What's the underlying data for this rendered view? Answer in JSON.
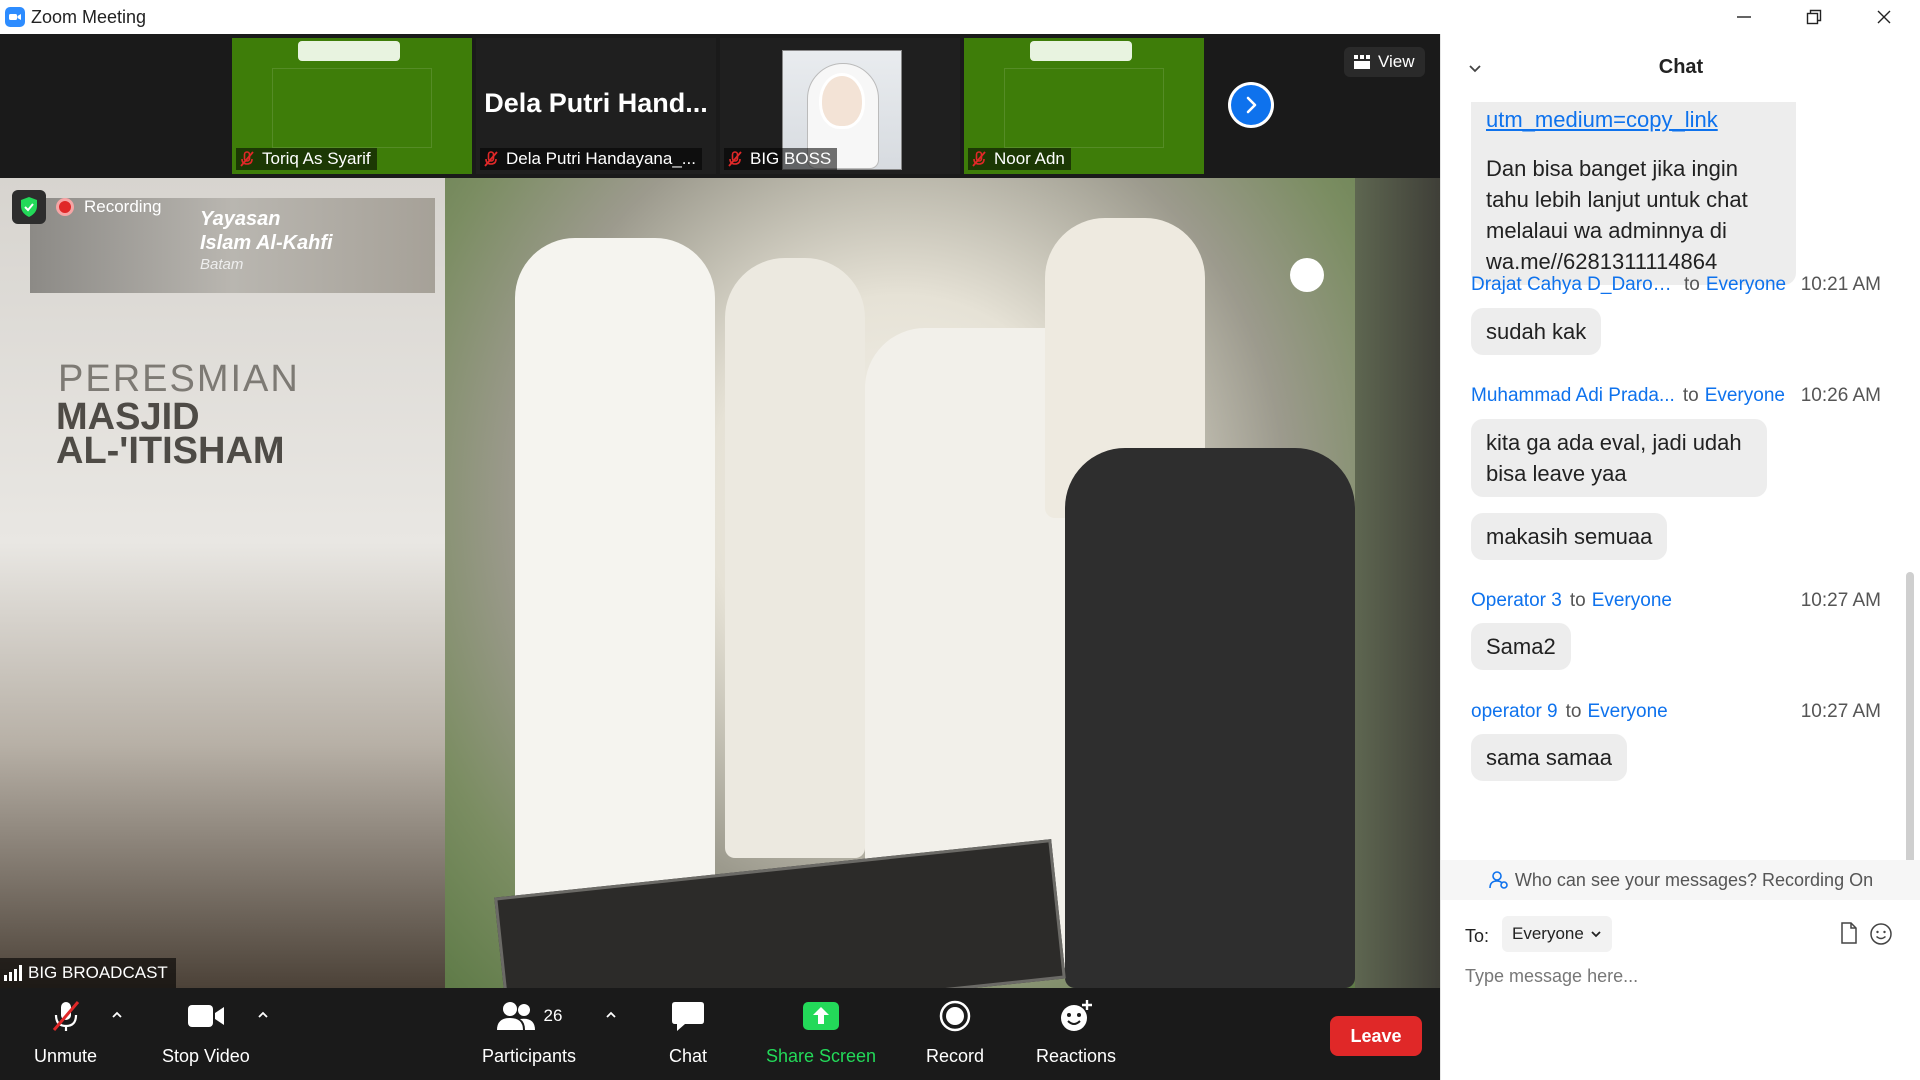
{
  "window": {
    "title": "Zoom Meeting",
    "controls": [
      "minimize-icon",
      "restore-icon",
      "close-icon"
    ]
  },
  "gallery": {
    "tiles": [
      {
        "name": "Toriq As Syarif",
        "muted": true,
        "style": "green-banner"
      },
      {
        "name": "Dela Putri Handayana_...",
        "big_name": "Dela Putri  Hand...",
        "muted": true,
        "style": "name-only"
      },
      {
        "name": "BIG BOSS",
        "muted": true,
        "style": "avatar"
      },
      {
        "name": "Noor Adn",
        "muted": true,
        "style": "green-banner"
      }
    ],
    "next_icon": "chevron-right-icon",
    "view_label": "View"
  },
  "main_video": {
    "recording_label": "Recording",
    "speaker_name": "BIG BROADCAST",
    "overlay_text": {
      "org_line1": "Yayasan",
      "org_line2": "Islam Al-Kahfi",
      "org_line3": "Batam",
      "event_line1": "PERESMIAN",
      "event_line2": "MASJID",
      "event_line3": "AL-'ITISHAM"
    }
  },
  "toolbar": {
    "unmute": "Unmute",
    "stop_video": "Stop Video",
    "participants": "Participants",
    "participants_count": "26",
    "chat": "Chat",
    "share_screen": "Share Screen",
    "record": "Record",
    "reactions": "Reactions",
    "leave": "Leave",
    "share_color": "#23d959",
    "leave_color": "#e02828"
  },
  "chat": {
    "title": "Chat",
    "first_bubble": {
      "link": "utm_medium=copy_link",
      "text": "Dan bisa banget jika ingin tahu lebih lanjut untuk chat melalaui wa adminnya di wa.me//6281311114864"
    },
    "messages": [
      {
        "sender": "Drajat Cahya D_Daroo...",
        "to": "to",
        "target": "Everyone",
        "time": "10:21 AM",
        "bubbles": [
          "sudah kak"
        ]
      },
      {
        "sender": "Muhammad Adi Prada...",
        "to": "to",
        "target": "Everyone",
        "time": "10:26 AM",
        "bubbles": [
          "kita ga ada eval, jadi udah bisa leave yaa",
          "makasih semuaa"
        ]
      },
      {
        "sender": "Operator 3",
        "to": "to",
        "target": "Everyone",
        "time": "10:27 AM",
        "bubbles": [
          "Sama2"
        ]
      },
      {
        "sender": "operator 9",
        "to": "to",
        "target": "Everyone",
        "time": "10:27 AM",
        "bubbles": [
          "sama samaa"
        ]
      }
    ],
    "visibility_note": "Who can see your messages? Recording On",
    "to_label": "To:",
    "to_value": "Everyone",
    "input_placeholder": "Type message here...",
    "accent": "#0e72ed"
  }
}
